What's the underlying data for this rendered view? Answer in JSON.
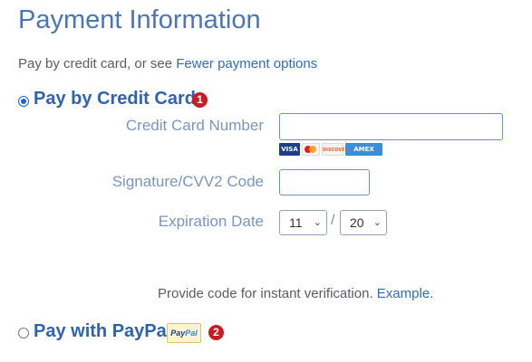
{
  "header": {
    "title": "Payment Information",
    "subline_prefix": "Pay by credit card, or see ",
    "subline_link": "Fewer payment options"
  },
  "credit_card_option": {
    "label": "Pay by Credit Card",
    "badge": "1",
    "selected": true,
    "fields": {
      "card_number_label": "Credit Card Number",
      "card_number_value": "",
      "cvv_label": "Signature/CVV2 Code",
      "cvv_value": "",
      "expiration_label": "Expiration Date",
      "exp_month": "11",
      "exp_year": "20",
      "separator": "/"
    },
    "accepted_cards": [
      "VISA",
      "MasterCard",
      "DISCOVER",
      "AMEX"
    ]
  },
  "verification": {
    "text": "Provide code for instant verification. ",
    "link": "Example."
  },
  "paypal_option": {
    "label": "Pay with PayPal",
    "logo_text_a": "Pay",
    "logo_text_b": "Pal",
    "badge": "2",
    "selected": false
  },
  "colors": {
    "title": "#4a76b8",
    "link": "#2f6cbf",
    "option_title": "#2e63b0",
    "field_label": "#7b95bd",
    "badge": "#c81e23"
  }
}
